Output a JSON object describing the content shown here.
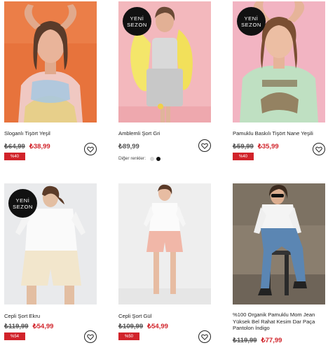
{
  "badge": {
    "line1": "YENİ",
    "line2": "SEZON"
  },
  "products": [
    {
      "name": "Sloganlı Tişört Yeşil",
      "old_price": "₺64,99",
      "price": "₺38,99",
      "discount": "%40"
    },
    {
      "name": "Amblemli Şort Gri",
      "price": "₺89,99",
      "colors_label": "Diğer renkler:",
      "colors": [
        "#d9d9d9",
        "#111111"
      ]
    },
    {
      "name": "Pamuklu Baskılı Tişört Nane Yeşili",
      "old_price": "₺59,99",
      "price": "₺35,99",
      "discount": "%40"
    },
    {
      "name": "Cepli Şort Ekru",
      "old_price": "₺119,99",
      "price": "₺54,99",
      "discount": "%54"
    },
    {
      "name": "Cepli Şort Gül",
      "old_price": "₺109,99",
      "price": "₺54,99",
      "discount": "%50"
    },
    {
      "name": "%100 Organik Pamuklu Mom Jean Yüksek Bel Rahat Kesim Dar Paça Pantolon İndigo",
      "old_price": "₺119,99",
      "price": "₺77,99"
    }
  ],
  "colors": {
    "sale_red": "#d1232a"
  }
}
